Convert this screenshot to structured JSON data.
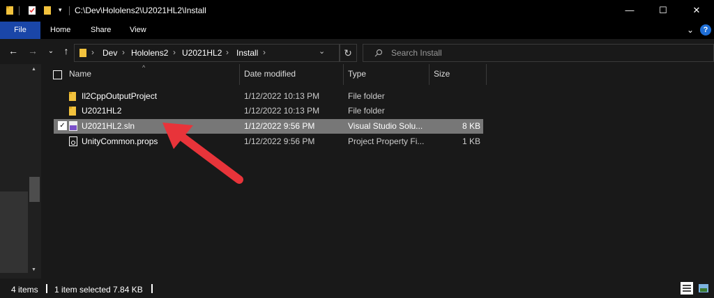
{
  "window": {
    "title": "C:\\Dev\\Hololens2\\U2021HL2\\Install",
    "minimize": "—",
    "maximize": "☐",
    "close": "✕"
  },
  "ribbon": {
    "tabs": [
      "File",
      "Home",
      "Share",
      "View"
    ],
    "help": "?"
  },
  "address": {
    "crumbs": [
      "Dev",
      "Hololens2",
      "U2021HL2",
      "Install"
    ],
    "search_placeholder": "Search Install"
  },
  "columns": {
    "name": "Name",
    "date": "Date modified",
    "type": "Type",
    "size": "Size"
  },
  "files": [
    {
      "name": "Il2CppOutputProject",
      "date": "1/12/2022 10:13 PM",
      "type": "File folder",
      "size": "",
      "icon": "folder-icon",
      "selected": false
    },
    {
      "name": "U2021HL2",
      "date": "1/12/2022 10:13 PM",
      "type": "File folder",
      "size": "",
      "icon": "folder-icon",
      "selected": false
    },
    {
      "name": "U2021HL2.sln",
      "date": "1/12/2022 9:56 PM",
      "type": "Visual Studio Solu...",
      "size": "8 KB",
      "icon": "visual-studio-solution-icon",
      "selected": true
    },
    {
      "name": "UnityCommon.props",
      "date": "1/12/2022 9:56 PM",
      "type": "Project Property Fi...",
      "size": "1 KB",
      "icon": "property-file-icon",
      "selected": false
    }
  ],
  "status": {
    "items": "4 items",
    "selected": "1 item selected  7.84 KB"
  },
  "colors": {
    "accent": "#1a46a8",
    "selection": "#777777",
    "arrow": "#e8343a",
    "folder": "#f2c23d"
  }
}
